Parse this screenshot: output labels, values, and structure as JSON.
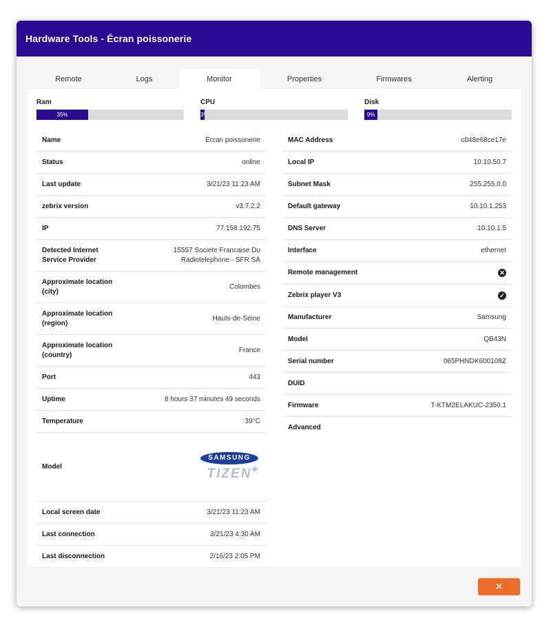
{
  "window": {
    "title": "Hardware Tools - Écran poissonerie"
  },
  "tabs": [
    {
      "label": "Remote"
    },
    {
      "label": "Logs"
    },
    {
      "label": "Monitor"
    },
    {
      "label": "Properties"
    },
    {
      "label": "Firmwares"
    },
    {
      "label": "Alerting"
    }
  ],
  "active_tab": "Monitor",
  "meters": {
    "ram": {
      "label": "Ram",
      "text": "35%",
      "fraction": 0.35
    },
    "cpu": {
      "label": "CPU",
      "text": "3%",
      "fraction": 0.03
    },
    "disk": {
      "label": "Disk",
      "text": "9%",
      "fraction": 0.09
    }
  },
  "left": {
    "name": {
      "key": "Name",
      "value": "Écran poissonerie"
    },
    "status": {
      "key": "Status",
      "value": "online"
    },
    "last_update": {
      "key": "Last update",
      "value": "3/21/23 11:23 AM"
    },
    "zebrix_version": {
      "key": "zebrix version",
      "value": "v3.7.2.2"
    },
    "ip": {
      "key": "IP",
      "value": "77.158.192.75"
    },
    "isp": {
      "key": "Detected Internet Service Provider",
      "value": "15557 Societe Francaise Du Radiotelephone - SFR SA"
    },
    "city": {
      "key": "Approximate location (city)",
      "value": "Colombes"
    },
    "region": {
      "key": "Approximate location (region)",
      "value": "Hauts-de-Seine"
    },
    "country": {
      "key": "Approximate location (country)",
      "value": "France"
    },
    "port": {
      "key": "Port",
      "value": "443"
    },
    "uptime": {
      "key": "Uptime",
      "value": "8 hours 37 minutes 49 seconds"
    },
    "temperature": {
      "key": "Temperature",
      "value": "39°C"
    },
    "model": {
      "key": "Model",
      "logo_top": "SAMSUNG",
      "logo_bottom": "TIZEN"
    },
    "local_screen_date": {
      "key": "Local screen date",
      "value": "3/21/23 11:23 AM"
    },
    "last_connection": {
      "key": "Last connection",
      "value": "3/21/23 4:30 AM"
    },
    "last_disconnection": {
      "key": "Last disconnection",
      "value": "2/16/23 2:05 PM"
    }
  },
  "right": {
    "mac": {
      "key": "MAC Address",
      "value": "c048e68ce17e"
    },
    "local_ip": {
      "key": "Local IP",
      "value": "10.10.50.7"
    },
    "subnet": {
      "key": "Subnet Mask",
      "value": "255.255.0.0"
    },
    "gateway": {
      "key": "Default gateway",
      "value": "10.10.1.253"
    },
    "dns": {
      "key": "DNS Server",
      "value": "10.10.1.5"
    },
    "interface": {
      "key": "Interface",
      "value": "ethernet"
    },
    "remote_mgmt": {
      "key": "Remote management",
      "icon": "x-circle-icon"
    },
    "player_v3": {
      "key": "Zebrix player V3",
      "icon": "check-circle-icon"
    },
    "manufacturer": {
      "key": "Manufacturer",
      "value": "Samsung"
    },
    "model": {
      "key": "Model",
      "value": "QB43N"
    },
    "serial": {
      "key": "Serial number",
      "value": "065PHNDK600108Z"
    },
    "duid": {
      "key": "DUID",
      "value": ""
    },
    "firmware": {
      "key": "Firmware",
      "value": "T-KTM2ELAKUC-2350.1"
    },
    "advanced": {
      "key": "Advanced"
    }
  },
  "footer": {
    "close_icon": "close-icon",
    "close_glyph": "✕"
  },
  "colors": {
    "header": "#2b0a92",
    "accent": "#2b0a92",
    "close_button": "#ec6a2a"
  }
}
